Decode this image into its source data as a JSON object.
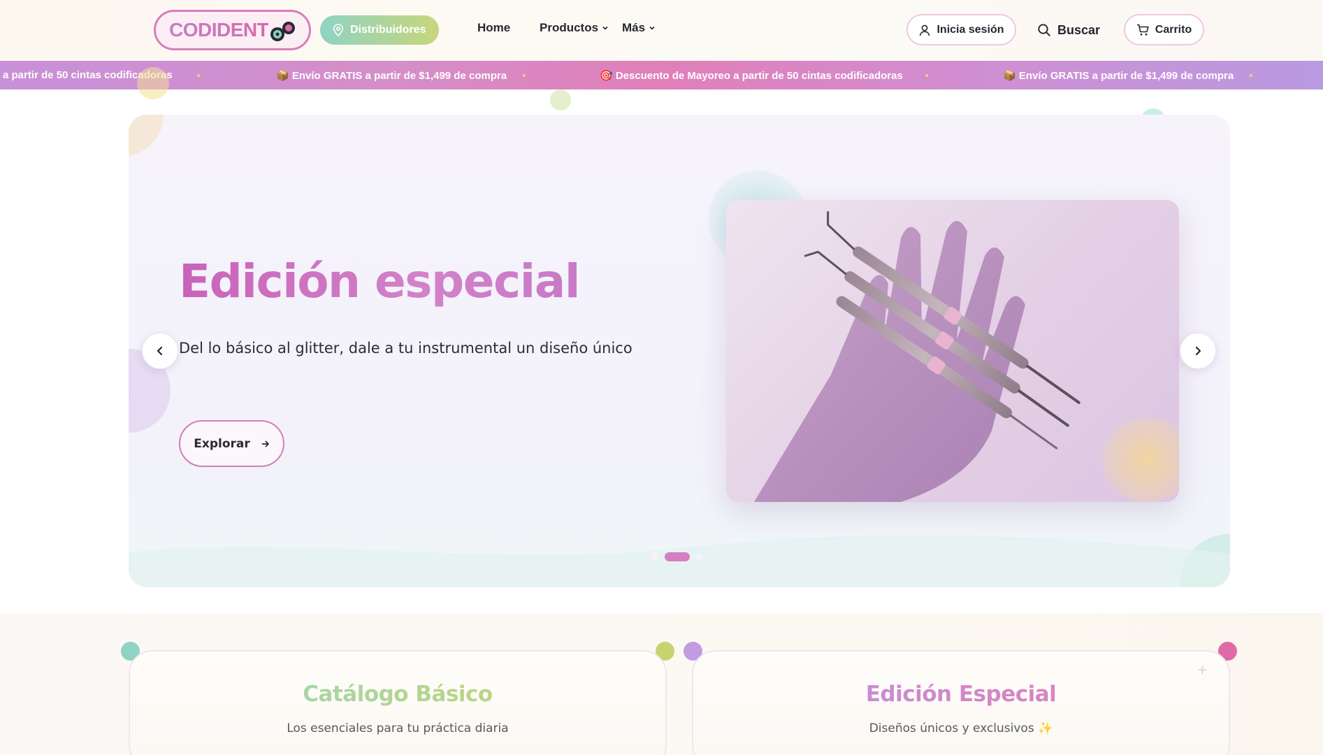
{
  "header": {
    "logo_text": "CODIDENT",
    "distributors_label": "Distribuidores",
    "nav": {
      "home": "Home",
      "products": "Productos",
      "more": "Más"
    },
    "login_label": "Inicia sesión",
    "search_label": "Buscar",
    "cart_label": "Carrito"
  },
  "ticker": {
    "items": [
      "a partir de 50 cintas codificadoras",
      "📦 Envío GRATIS a partir de $1,499 de compra",
      "🎯 Descuento de Mayoreo a partir de 50 cintas codificadoras",
      "📦 Envío GRATIS a partir de $1,499 de compra"
    ]
  },
  "hero": {
    "title": "Edición especial",
    "subtitle": "Del lo básico al glitter, dale a tu instrumental un diseño único",
    "cta_label": "Explorar",
    "slide_count": 3,
    "active_slide": 2
  },
  "categories": [
    {
      "title": "Catálogo Básico",
      "subtitle": "Los esenciales para tu práctica diaria"
    },
    {
      "title": "Edición Especial",
      "subtitle": "Diseños únicos y exclusivos ✨"
    }
  ],
  "colors": {
    "brand_pink": "#d47ec4",
    "brand_mint": "#8fd3c3",
    "brand_lime": "#c7d67a",
    "brand_lavender": "#b995e0"
  },
  "icons": {
    "location": "location-pin-icon",
    "user": "user-icon",
    "search": "search-icon",
    "cart": "cart-icon",
    "chevron": "chevron-down-icon",
    "arrow_left": "chevron-left-icon",
    "arrow_right": "chevron-right-icon",
    "cta_arrow": "arrow-right-icon"
  }
}
